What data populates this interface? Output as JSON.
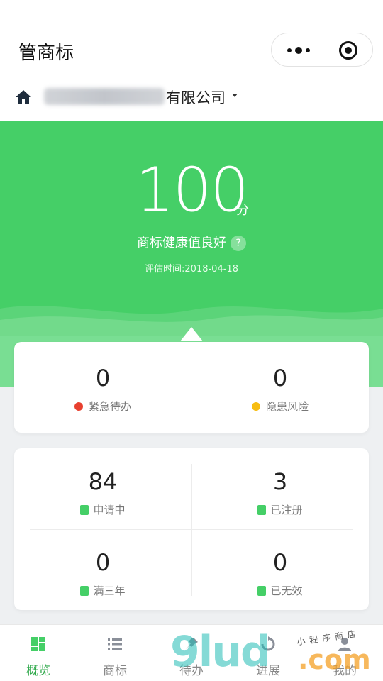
{
  "nav": {
    "title": "管商标"
  },
  "company": {
    "name_suffix": "有限公司"
  },
  "hero": {
    "score": "100",
    "unit": "分",
    "status": "商标健康值良好",
    "help": "?",
    "eval_time": "评估时间:2018-04-18"
  },
  "alerts": [
    {
      "value": "0",
      "label": "紧急待办",
      "color": "#e8402f"
    },
    {
      "value": "0",
      "label": "隐患风险",
      "color": "#f7bd12"
    }
  ],
  "stats": [
    {
      "value": "84",
      "label": "申请中"
    },
    {
      "value": "3",
      "label": "已注册"
    },
    {
      "value": "0",
      "label": "满三年"
    },
    {
      "value": "0",
      "label": "已无效"
    }
  ],
  "tabs": [
    {
      "label": "概览",
      "icon": "dashboard-icon"
    },
    {
      "label": "商标",
      "icon": "list-icon"
    },
    {
      "label": "待办",
      "icon": "pin-icon"
    },
    {
      "label": "进展",
      "icon": "progress-icon"
    },
    {
      "label": "我的",
      "icon": "user-icon"
    }
  ],
  "watermark": {
    "main": "9lud",
    "suffix": ".com",
    "sub": "小程序商店"
  },
  "colors": {
    "brand_green": "#45cf67",
    "tab_active": "#2ea84a"
  }
}
